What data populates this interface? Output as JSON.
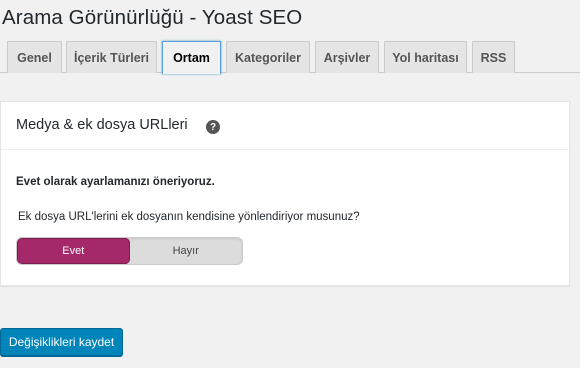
{
  "page": {
    "title": "Arama Görünürlüğü - Yoast SEO"
  },
  "tabs": [
    {
      "label": "Genel"
    },
    {
      "label": "İçerik Türleri"
    },
    {
      "label": "Ortam",
      "active": true
    },
    {
      "label": "Kategoriler"
    },
    {
      "label": "Arşivler"
    },
    {
      "label": "Yol haritası"
    },
    {
      "label": "RSS"
    }
  ],
  "panel": {
    "title": "Medya & ek dosya URLleri",
    "help_icon": "question-circle-icon",
    "recommendation": "Evet olarak ayarlamanızı öneriyoruz.",
    "question": "Ek dosya URL'lerini ek dosyanın kendisine yönlendiriyor musunuz?",
    "toggle": {
      "yes_label": "Evet",
      "no_label": "Hayır",
      "selected": "Evet"
    }
  },
  "actions": {
    "save_label": "Değişiklikleri kaydet"
  },
  "colors": {
    "accent": "#a4286a",
    "button": "#0085ba"
  }
}
